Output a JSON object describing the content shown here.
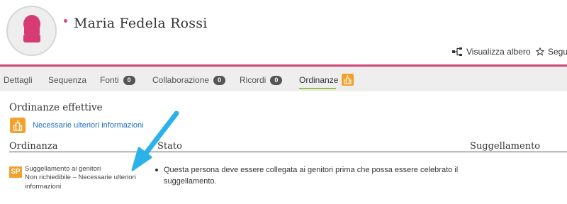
{
  "header": {
    "person_name": "Maria Fedela Rossi",
    "actions": {
      "tree_label": "Visualizza albero",
      "follow_label": "Segui"
    }
  },
  "tabs": [
    {
      "label": "Dettagli"
    },
    {
      "label": "Sequenza"
    },
    {
      "label": "Fonti",
      "count": "0"
    },
    {
      "label": "Collaborazione",
      "count": "0"
    },
    {
      "label": "Ricordi",
      "count": "0"
    },
    {
      "label": "Ordinanze",
      "active": true,
      "icon": "temple-icon"
    }
  ],
  "section": {
    "title": "Ordinanze effettive",
    "status_link": "Necessarie ulteriori informazioni",
    "columns": {
      "ordinance": "Ordinanza",
      "status": "Stato",
      "sealing": "Suggellamento"
    },
    "rows": [
      {
        "badge": "SP",
        "name": "Suggellamento ai genitori",
        "status": "Non richiedibile – Necessarie ulteriori informazioni",
        "bullet": "Questa persona deve essere collegata ai genitori prima che possa essere celebrato il suggellamento."
      }
    ]
  },
  "colors": {
    "accent_pink": "#d1497a",
    "temple_orange": "#f2a12c",
    "link_blue": "#1b6fc0",
    "annotation_arrow": "#2bb2e8",
    "tab_underline": "#8fc445"
  }
}
